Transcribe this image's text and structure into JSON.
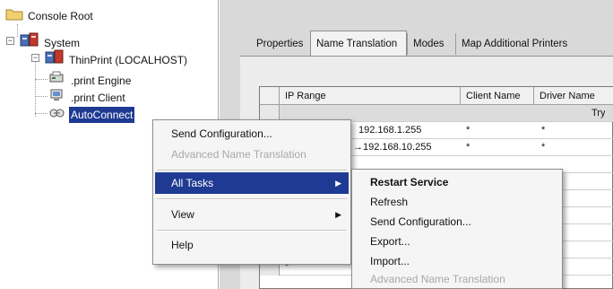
{
  "tree": {
    "root": "Console Root",
    "system": "System",
    "thinprint": "ThinPrint (LOCALHOST)",
    "engine": ".print Engine",
    "client": ".print Client",
    "autoconnect": "AutoConnect"
  },
  "tabs": [
    {
      "label": "Properties"
    },
    {
      "label": "Name Translation"
    },
    {
      "label": "Modes"
    },
    {
      "label": "Map Additional Printers"
    }
  ],
  "grid": {
    "columns": [
      "IP Range",
      "Client Name",
      "Driver Name"
    ],
    "band_text": "Try",
    "rows": [
      {
        "ip": "192.168.1.255",
        "client": "*",
        "driver": "*"
      },
      {
        "ip": "→192.168.10.255",
        "client": "*",
        "driver": "*"
      },
      {
        "ip": "",
        "client": "",
        "driver": ""
      },
      {
        "ip": "",
        "client": "",
        "driver": ""
      },
      {
        "ip": "",
        "client": "",
        "driver": ""
      },
      {
        "ip": "",
        "client": "",
        "driver": ""
      },
      {
        "ip": "",
        "client": "",
        "driver": ""
      },
      {
        "ip": "*",
        "client": "",
        "driver": ""
      }
    ]
  },
  "context_menu": {
    "send_config": "Send Configuration...",
    "advanced_name": "Advanced Name Translation",
    "all_tasks": "All Tasks",
    "view": "View",
    "help": "Help"
  },
  "submenu": {
    "restart": "Restart Service",
    "refresh": "Refresh",
    "send_config": "Send Configuration...",
    "export": "Export...",
    "import": "Import...",
    "advanced_name": "Advanced Name Translation"
  },
  "colors": {
    "selection": "#1f3a93",
    "pane": "#d9d9d9",
    "menu_bg": "#f5f5f5"
  }
}
